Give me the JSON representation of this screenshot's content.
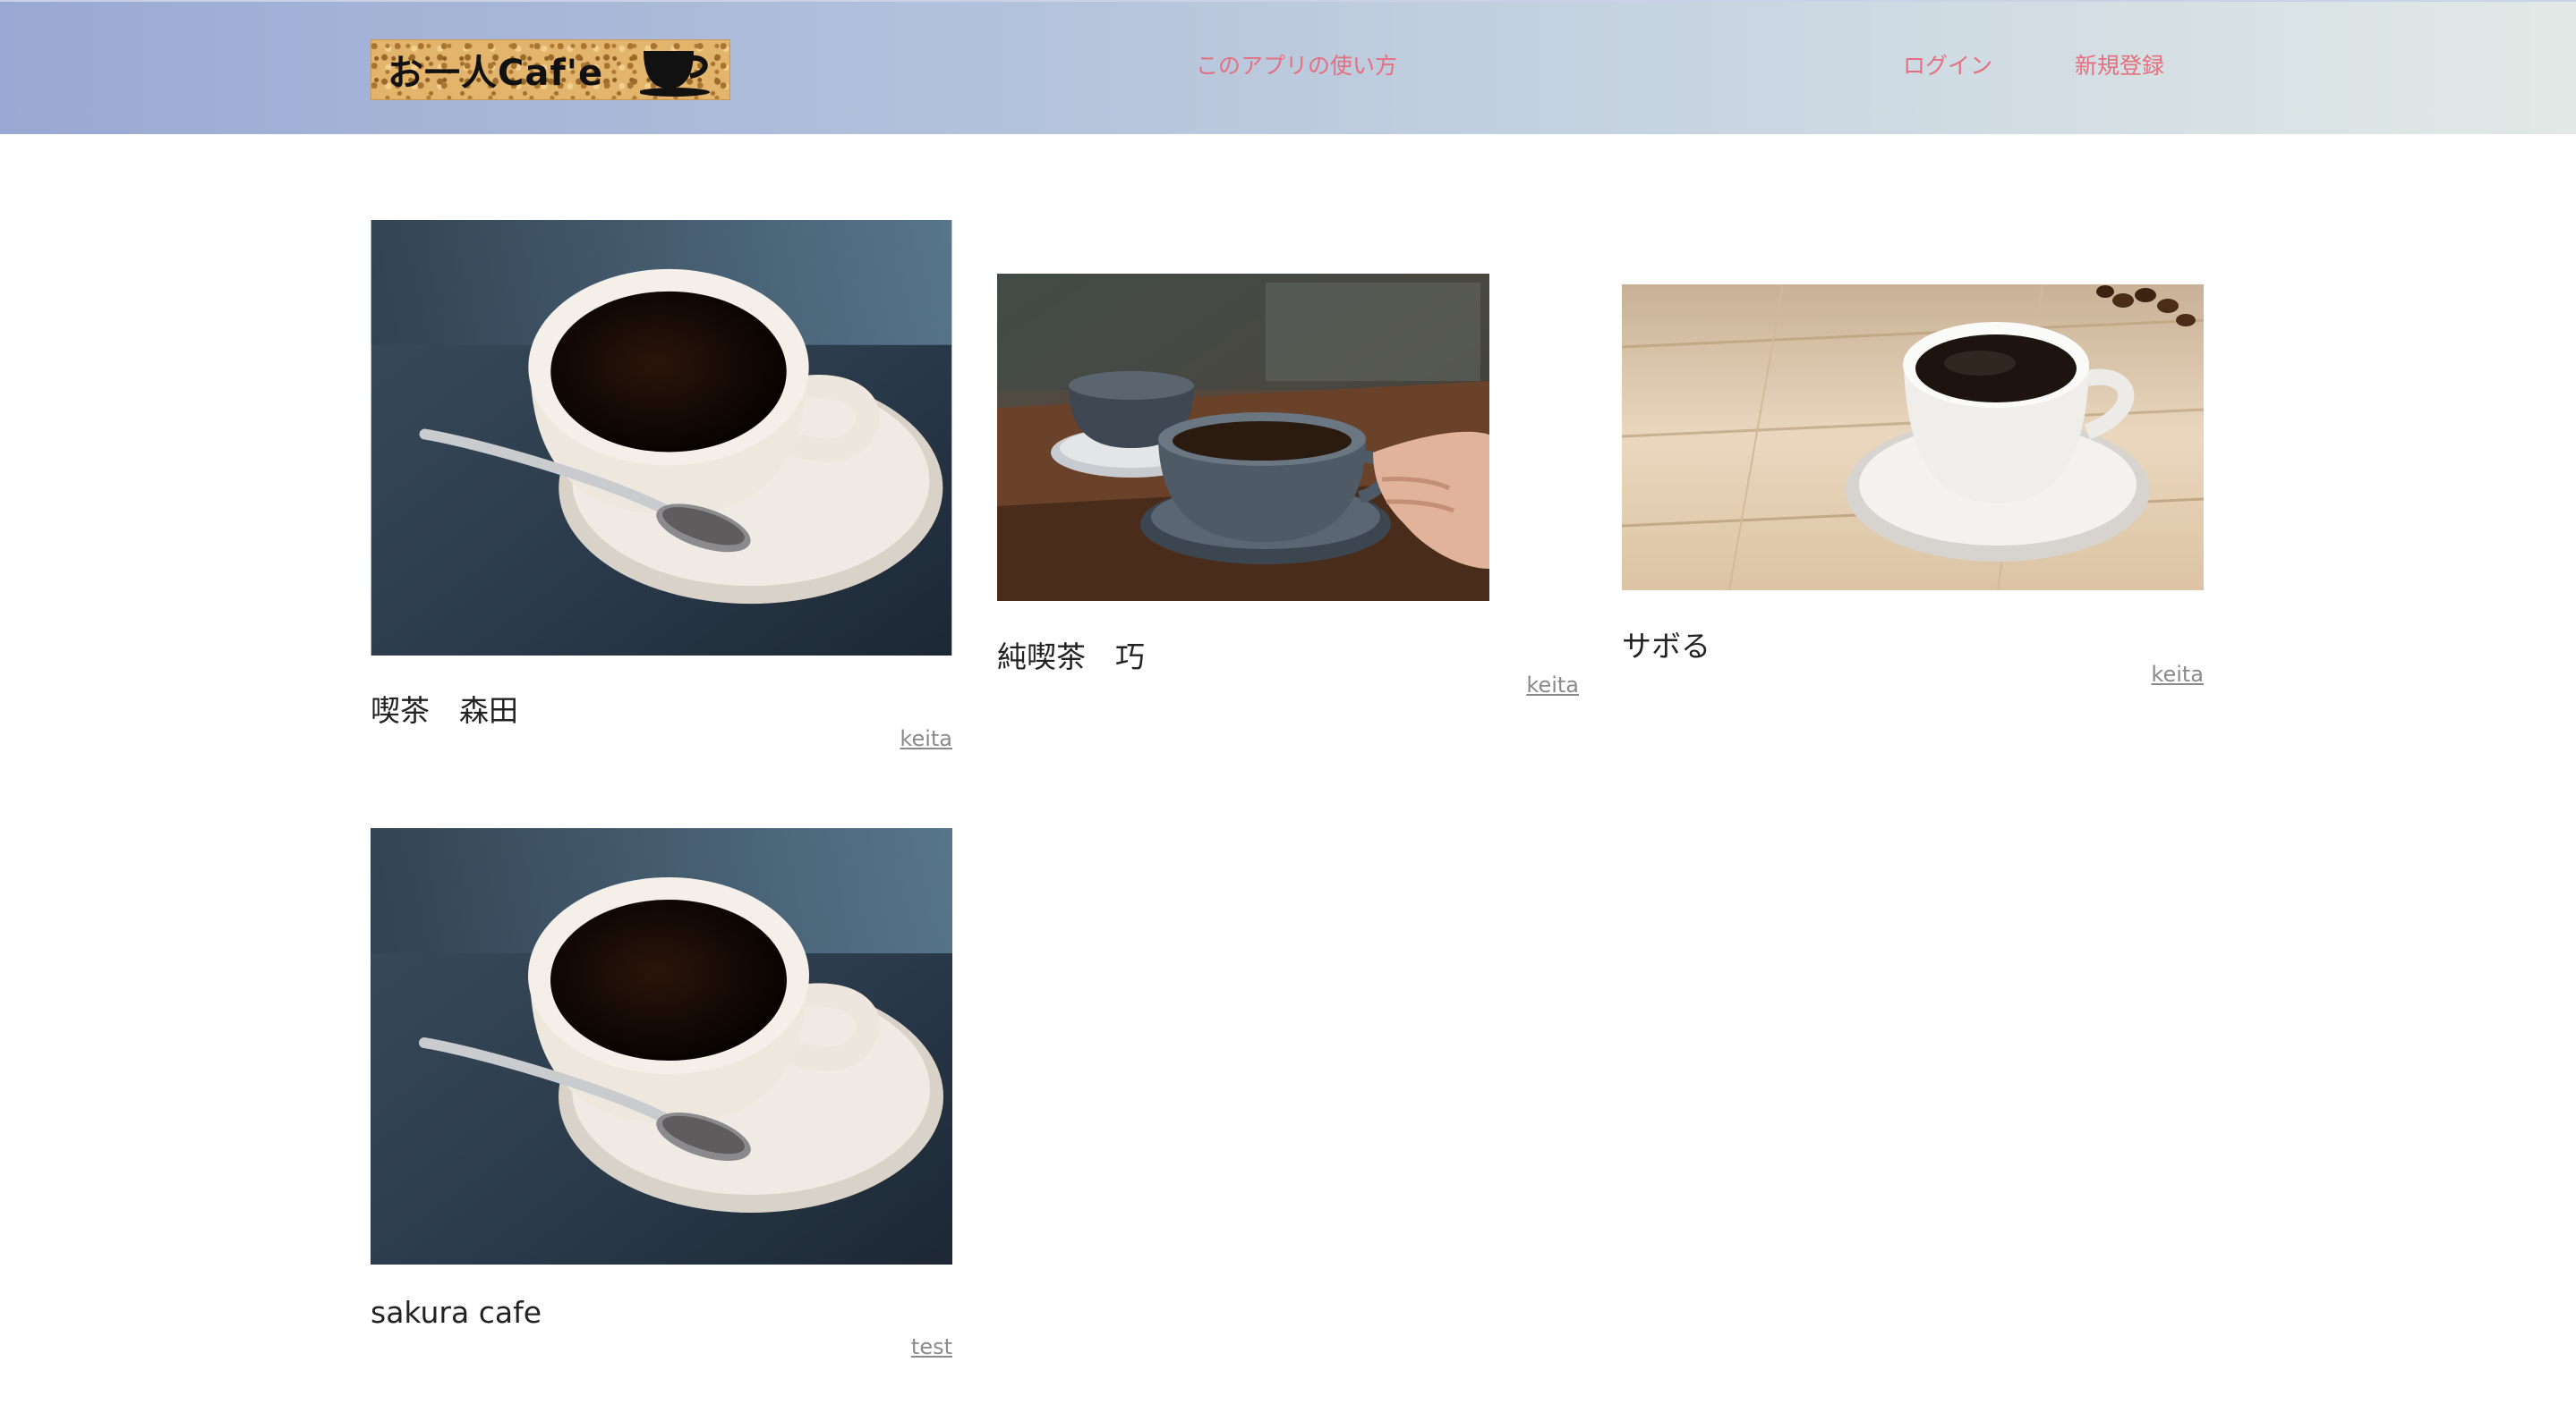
{
  "header": {
    "logo_text": "お一人Caf'e",
    "nav": {
      "howto": "このアプリの使い方",
      "login": "ログイン",
      "signup": "新規登録"
    }
  },
  "cafes": [
    {
      "name": "喫茶　森田",
      "author": "keita",
      "photo": "coffee-cup-spoon-dark-photo"
    },
    {
      "name": "純喫茶　巧",
      "author": "keita",
      "photo": "cafe-table-hand-cup-photo"
    },
    {
      "name": "サボる",
      "author": "keita",
      "photo": "white-cup-wood-table-photo"
    },
    {
      "name": "sakura cafe",
      "author": "test",
      "photo": "coffee-cup-spoon-dark-photo"
    }
  ],
  "colors": {
    "nav_link": "#e46f7e",
    "header_gradient_start": "#9aa9d3",
    "header_gradient_end": "#e2e9e6"
  }
}
